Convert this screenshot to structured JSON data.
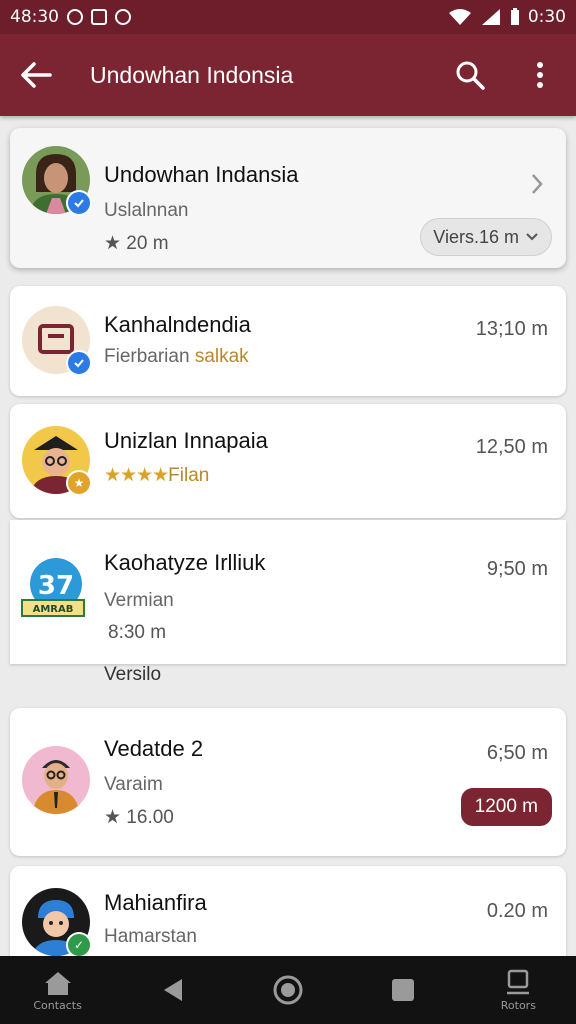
{
  "status_bar": {
    "time": "48:30",
    "clock": "0:30"
  },
  "app_bar": {
    "title": "Undowhan Indonsia"
  },
  "featured": {
    "name": "Undowhan Indansia",
    "subtitle": "Uslalnnan",
    "rating": "★ 20 m",
    "chip_label": "Viers.16 m"
  },
  "items": [
    {
      "name": "Kanhalndendia",
      "sub_prefix": "Fierbarian",
      "sub_highlight": "salkak",
      "time": "13;10 m"
    },
    {
      "name": "Unizlan Innapaia",
      "stars": "★★★★",
      "sub": "Filan",
      "time": "12,50 m"
    },
    {
      "name": "Kaohatyze Irlliuk",
      "sub": "Vermian",
      "meta": "8:30 m",
      "time": "9;50 m"
    },
    {
      "name": "Vedatde 2",
      "sub": "Varaim",
      "meta": "★ 16.00",
      "time": "6;50 m",
      "pill": "1200 m"
    },
    {
      "name": "Mahianfira",
      "sub": "Hamarstan",
      "time": "0.20 m"
    }
  ],
  "section_label": "Versilo",
  "avatar_labels": {
    "badge": "37",
    "banner": "AMRAB"
  },
  "nav": {
    "home_label": "Contacts",
    "right_label": "Rotors"
  }
}
